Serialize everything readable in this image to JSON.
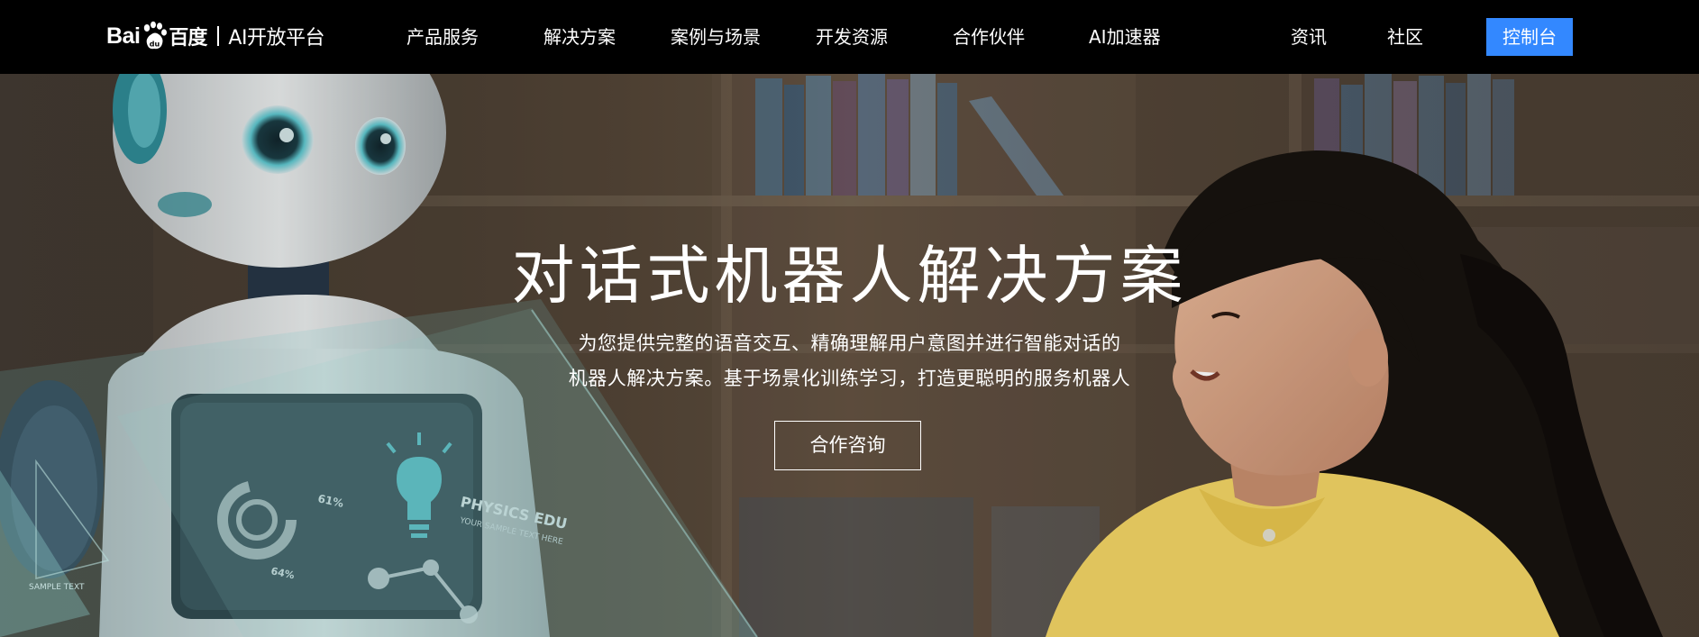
{
  "nav": {
    "logo": {
      "bai": "Bai",
      "du_cn": "百度",
      "platform": "AI开放平台"
    },
    "items": [
      {
        "label": "产品服务"
      },
      {
        "label": "解决方案"
      },
      {
        "label": "案例与场景"
      },
      {
        "label": "开发资源"
      },
      {
        "label": "合作伙伴"
      },
      {
        "label": "AI加速器"
      },
      {
        "label": "资讯"
      },
      {
        "label": "社区"
      }
    ],
    "console_label": "控制台",
    "accent_color": "#3388ff"
  },
  "hero": {
    "title": "对话式机器人解决方案",
    "description_line1": "为您提供完整的语音交互、精确理解用户意图并进行智能对话的",
    "description_line2": "机器人解决方案。基于场景化训练学习，打造更聪明的服务机器人",
    "cta_label": "合作咨询",
    "screen_text": {
      "stat_a": "61%",
      "stat_b": "64%",
      "headline": "PHYSICS EDU",
      "subhead": "YOUR SAMPLE TEXT HERE",
      "sample": "SAMPLE TEXT"
    }
  }
}
